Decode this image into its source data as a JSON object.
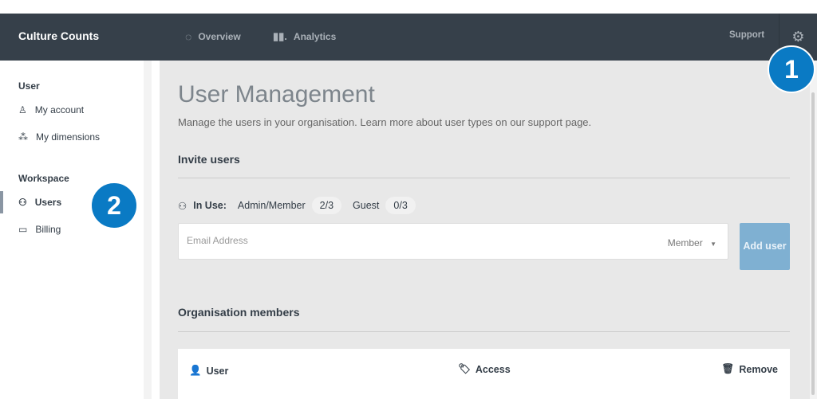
{
  "header": {
    "brand": "Culture Counts",
    "nav": [
      {
        "label": "Overview",
        "icon": "loading-circle-icon"
      },
      {
        "label": "Analytics",
        "icon": "bar-chart-icon"
      }
    ],
    "support": "Support",
    "settings_icon": "gear-icon"
  },
  "sidebar": {
    "user_heading": "User",
    "user_items": [
      {
        "label": "My account",
        "icon": "person-icon"
      },
      {
        "label": "My dimensions",
        "icon": "grid-icon"
      }
    ],
    "workspace_heading": "Workspace",
    "workspace_items": [
      {
        "label": "Users",
        "icon": "users-icon",
        "active": true
      },
      {
        "label": "Billing",
        "icon": "card-icon"
      }
    ]
  },
  "main": {
    "title": "User Management",
    "subtitle": "Manage the users in your organisation. Learn more about user types on our support page.",
    "invite": {
      "heading": "Invite users",
      "in_use_label": "In Use:",
      "admin_label": "Admin/Member",
      "admin_count": "2/3",
      "guest_label": "Guest",
      "guest_count": "0/3",
      "email_placeholder": "Email Address",
      "role_value": "Member",
      "add_button": "Add user"
    },
    "members": {
      "heading": "Organisation members",
      "columns": [
        "User",
        "Access",
        "Remove"
      ]
    }
  },
  "annotations": [
    "1",
    "2"
  ],
  "colors": {
    "nav": "#36404a",
    "badge": "#0a7ac4",
    "add_button": "#7fb0d2"
  }
}
